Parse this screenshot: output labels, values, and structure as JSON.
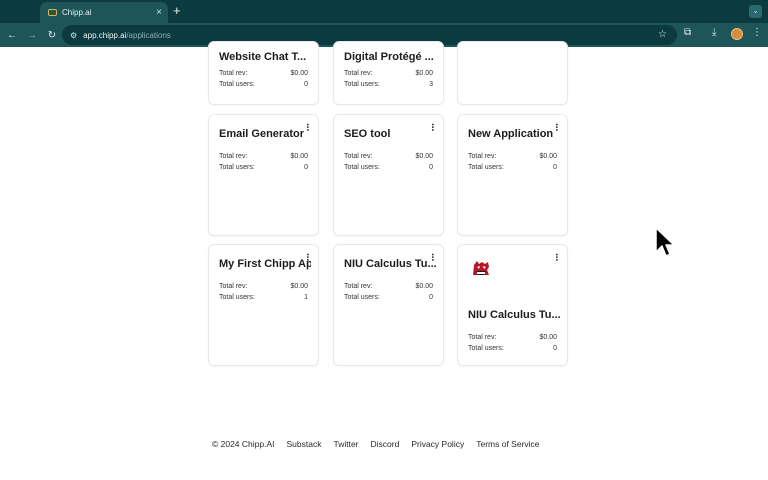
{
  "browser": {
    "tab_title": "Chipp.ai",
    "tab_close": "×",
    "new_tab": "+",
    "url_host": "app.chipp.ai",
    "url_path": "/applications",
    "icons": [
      "back-icon",
      "forward-icon",
      "reload-icon",
      "tune-icon",
      "star-icon",
      "extensions-icon",
      "download-icon",
      "menu-icon"
    ]
  },
  "stats_labels": {
    "rev": "Total rev:",
    "users": "Total users:"
  },
  "cards": [
    {
      "title": "Website Chat T...",
      "rev": "$0.00",
      "users": "0"
    },
    {
      "title": "Digital Protégé ...",
      "rev": "$0.00",
      "users": "3"
    },
    {
      "title": "",
      "rev": "",
      "users": ""
    },
    {
      "title": "Email Generator",
      "rev": "$0.00",
      "users": "0"
    },
    {
      "title": "SEO tool",
      "rev": "$0.00",
      "users": "0"
    },
    {
      "title": "New Application",
      "rev": "$0.00",
      "users": "0"
    },
    {
      "title": "My First Chipp Ap",
      "rev": "$0.00",
      "users": "1"
    },
    {
      "title": "NIU Calculus Tu...",
      "rev": "$0.00",
      "users": "0"
    },
    {
      "title": "NIU Calculus Tu...",
      "rev": "$0.00",
      "users": "0"
    }
  ],
  "footer": {
    "copyright": "© 2024 Chipp.AI",
    "links": [
      "Substack",
      "Twitter",
      "Discord",
      "Privacy Policy",
      "Terms of Service"
    ]
  },
  "colors": {
    "chrome_dark": "#0b3b3f",
    "chrome_toolbar": "#1d5559",
    "logo_red": "#b5172b"
  }
}
